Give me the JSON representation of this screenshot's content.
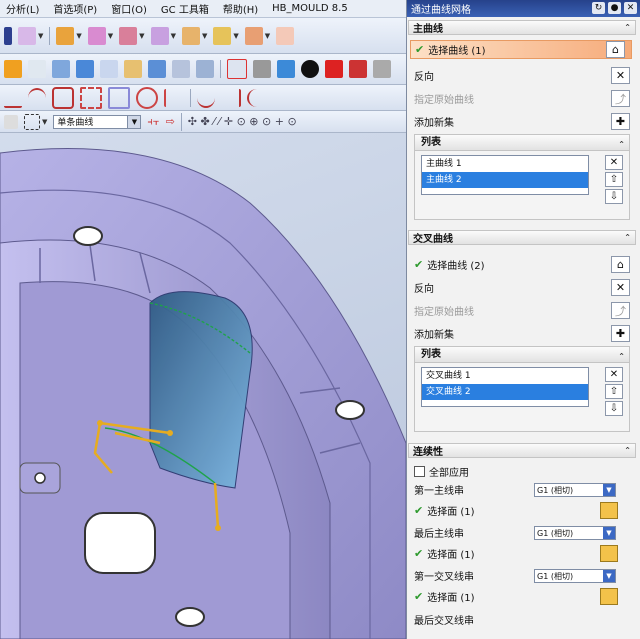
{
  "menubar": {
    "items": [
      "分析(L)",
      "首选项(P)",
      "窗口(O)",
      "GC 工具箱",
      "帮助(H)",
      "HB_MOULD 8.5"
    ]
  },
  "toolbar": {
    "filter_value": "单条曲线"
  },
  "dialog": {
    "title": "通过曲线网格",
    "primary": {
      "header": "主曲线",
      "select_label": "选择曲线 (1)",
      "reverse_label": "反向",
      "origin_label": "指定原始曲线",
      "add_label": "添加新集",
      "list_header": "列表",
      "items": [
        "主曲线 1",
        "主曲线 2"
      ]
    },
    "cross": {
      "header": "交叉曲线",
      "select_label": "选择曲线 (2)",
      "reverse_label": "反向",
      "origin_label": "指定原始曲线",
      "add_label": "添加新集",
      "list_header": "列表",
      "items": [
        "交叉曲线 1",
        "交叉曲线 2"
      ]
    },
    "continuity": {
      "header": "连续性",
      "apply_all_label": "全部应用",
      "first_primary_label": "第一主线串",
      "first_primary_value": "G1 (相切)",
      "select_face1": "选择面 (1)",
      "last_primary_label": "最后主线串",
      "last_primary_value": "G1 (相切)",
      "select_face2": "选择面 (1)",
      "first_cross_label": "第一交叉线串",
      "first_cross_value": "G1 (相切)",
      "select_face3": "选择面 (1)",
      "last_cross_label": "最后交叉线串"
    }
  },
  "colors": {
    "title_bar": "#2c4a99",
    "selection": "#2a7fe0",
    "model_body": "#9a96cf",
    "highlight_face": "#5f98c8",
    "curve_handles": "#e6ac20"
  }
}
